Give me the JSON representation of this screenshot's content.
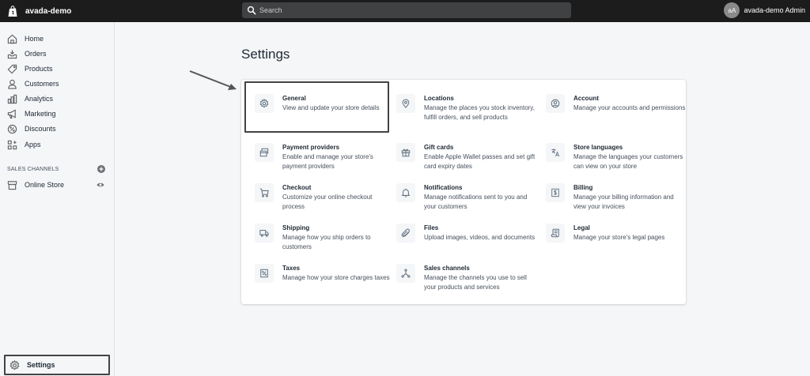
{
  "topbar": {
    "store_name": "avada-demo",
    "search_placeholder": "Search",
    "user_initials": "aA",
    "user_name": "avada-demo Admin"
  },
  "sidebar": {
    "items": [
      {
        "label": "Home",
        "icon": "home-icon"
      },
      {
        "label": "Orders",
        "icon": "orders-icon"
      },
      {
        "label": "Products",
        "icon": "tag-icon"
      },
      {
        "label": "Customers",
        "icon": "person-icon"
      },
      {
        "label": "Analytics",
        "icon": "bar-chart-icon"
      },
      {
        "label": "Marketing",
        "icon": "megaphone-icon"
      },
      {
        "label": "Discounts",
        "icon": "discount-icon"
      },
      {
        "label": "Apps",
        "icon": "apps-icon"
      }
    ],
    "sales_channels_label": "SALES CHANNELS",
    "online_store_label": "Online Store",
    "settings_label": "Settings"
  },
  "main": {
    "title": "Settings",
    "tiles": [
      {
        "title": "General",
        "desc": "View and update your store details",
        "icon": "gear-icon"
      },
      {
        "title": "Locations",
        "desc": "Manage the places you stock inventory, fulfill orders, and sell products",
        "icon": "location-pin-icon"
      },
      {
        "title": "Account",
        "desc": "Manage your accounts and permissions",
        "icon": "account-icon"
      },
      {
        "title": "Payment providers",
        "desc": "Enable and manage your store's payment providers",
        "icon": "credit-card-icon"
      },
      {
        "title": "Gift cards",
        "desc": "Enable Apple Wallet passes and set gift card expiry dates",
        "icon": "gift-icon"
      },
      {
        "title": "Store languages",
        "desc": "Manage the languages your customers can view on your store",
        "icon": "translate-icon"
      },
      {
        "title": "Checkout",
        "desc": "Customize your online checkout process",
        "icon": "cart-icon"
      },
      {
        "title": "Notifications",
        "desc": "Manage notifications sent to you and your customers",
        "icon": "bell-icon"
      },
      {
        "title": "Billing",
        "desc": "Manage your billing information and view your invoices",
        "icon": "dollar-icon"
      },
      {
        "title": "Shipping",
        "desc": "Manage how you ship orders to customers",
        "icon": "truck-icon"
      },
      {
        "title": "Files",
        "desc": "Upload images, videos, and documents",
        "icon": "paperclip-icon"
      },
      {
        "title": "Legal",
        "desc": "Manage your store's legal pages",
        "icon": "scroll-icon"
      },
      {
        "title": "Taxes",
        "desc": "Manage how your store charges taxes",
        "icon": "tax-icon"
      },
      {
        "title": "Sales channels",
        "desc": "Manage the channels you use to sell your products and services",
        "icon": "channels-icon"
      }
    ]
  },
  "colors": {
    "topbar": "#1c1c1c",
    "search": "#404142",
    "background": "#f4f6f8",
    "card": "#ffffff",
    "highlight_border": "#444444"
  }
}
